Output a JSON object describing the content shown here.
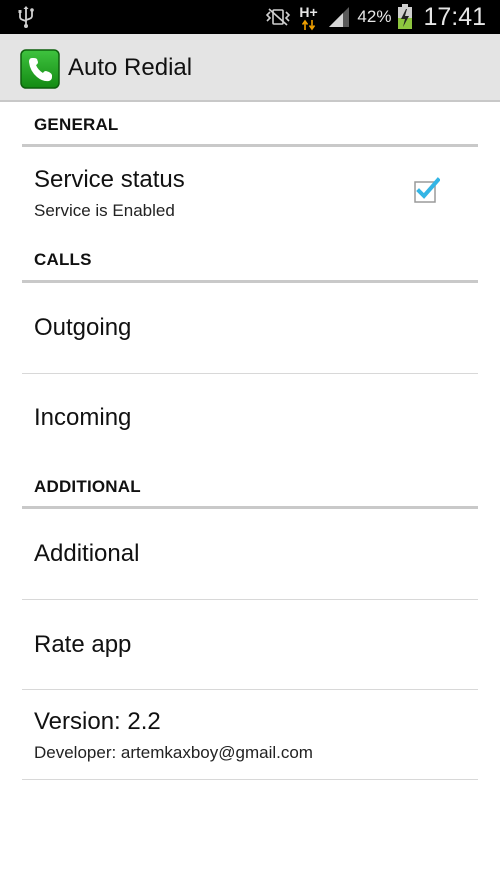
{
  "status_bar": {
    "network_type": "H+",
    "battery_percent": "42%",
    "time": "17:41",
    "icons": [
      "usb-icon",
      "vibrate-icon",
      "data-arrows-icon",
      "signal-icon",
      "battery-charging-icon"
    ]
  },
  "action_bar": {
    "title": "Auto Redial",
    "icon": "phone-icon",
    "icon_color": "#1f9e1f"
  },
  "sections": {
    "general": {
      "header": "GENERAL",
      "service_status": {
        "title": "Service status",
        "summary": "Service is Enabled",
        "checked": true
      }
    },
    "calls": {
      "header": "CALLS",
      "outgoing": {
        "title": "Outgoing"
      },
      "incoming": {
        "title": "Incoming"
      }
    },
    "additional": {
      "header": "ADDITIONAL",
      "additional": {
        "title": "Additional"
      },
      "rate_app": {
        "title": "Rate app"
      },
      "version": {
        "title": "Version: 2.2",
        "summary": "Developer: artemkaxboy@gmail.com"
      }
    }
  },
  "colors": {
    "accent": "#33b5e5",
    "status_bar_bg": "#000000",
    "action_bar_bg": "#e4e4e4",
    "divider": "#d8d8d8",
    "header_underline": "#c9c9c9"
  }
}
